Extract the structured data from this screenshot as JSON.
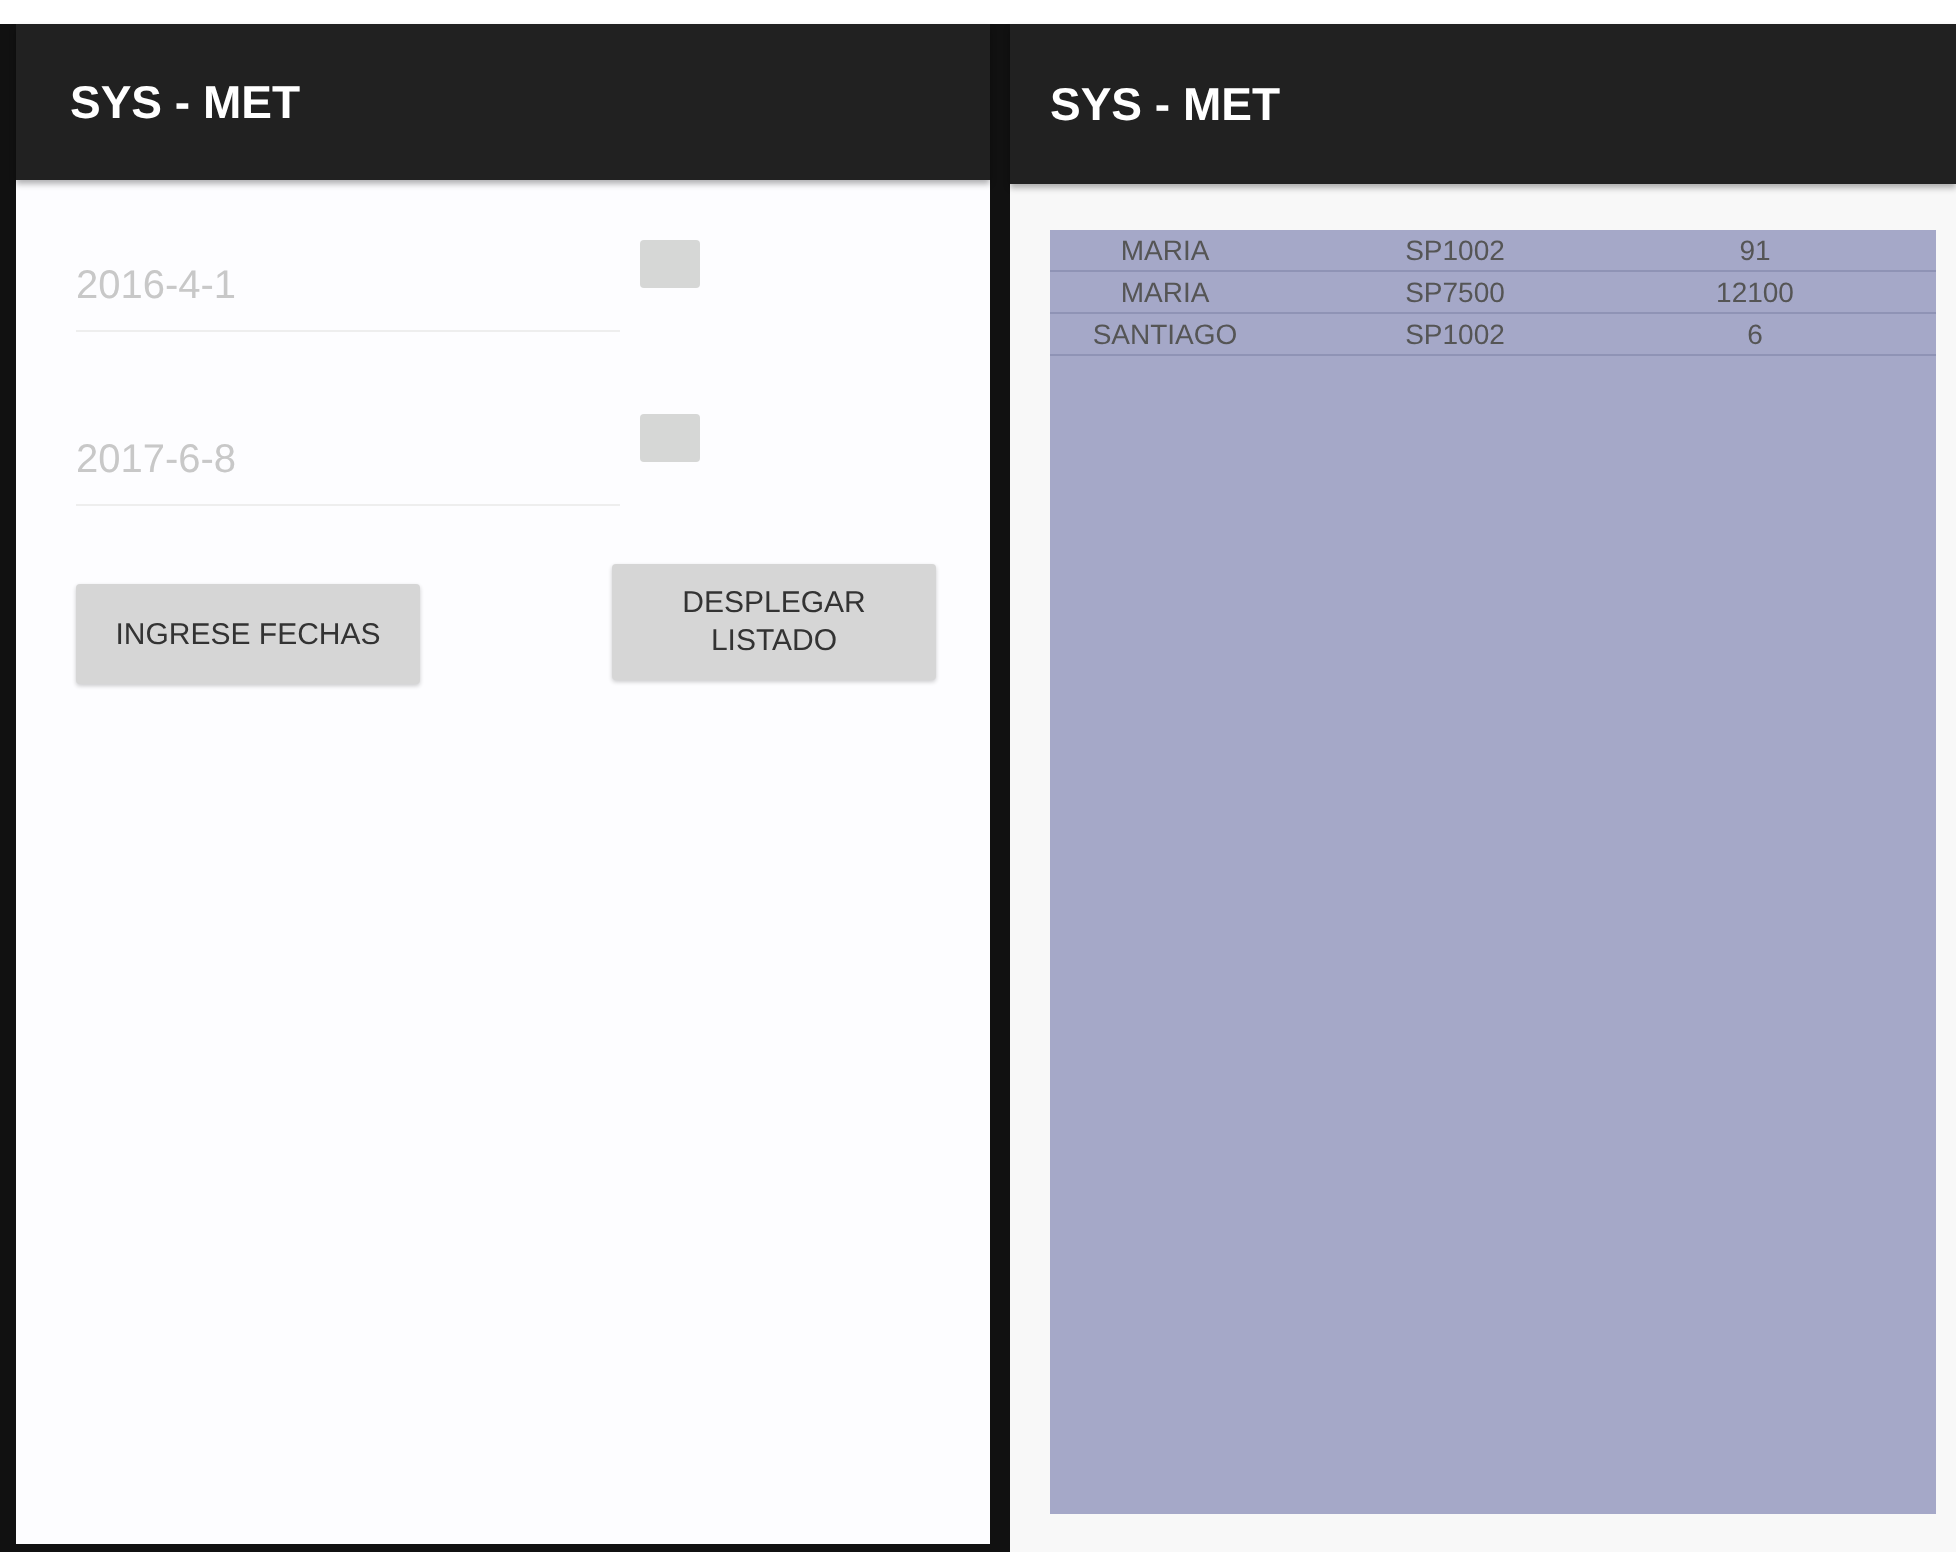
{
  "screens": [
    {
      "kind": "form",
      "title": "SYS - MET",
      "date_fields": [
        {
          "placeholder": "2016-4-1"
        },
        {
          "placeholder": "2017-6-8"
        }
      ],
      "buttons": [
        "INGRESE FECHAS",
        "DESPLEGAR LISTADO"
      ]
    },
    {
      "kind": "list",
      "title": "SYS - MET",
      "table": {
        "rows": [
          [
            "MARIA",
            "SP1002",
            "91"
          ],
          [
            "MARIA",
            "SP7500",
            "12100"
          ],
          [
            "SANTIAGO",
            "SP1002",
            "6"
          ]
        ]
      }
    }
  ]
}
